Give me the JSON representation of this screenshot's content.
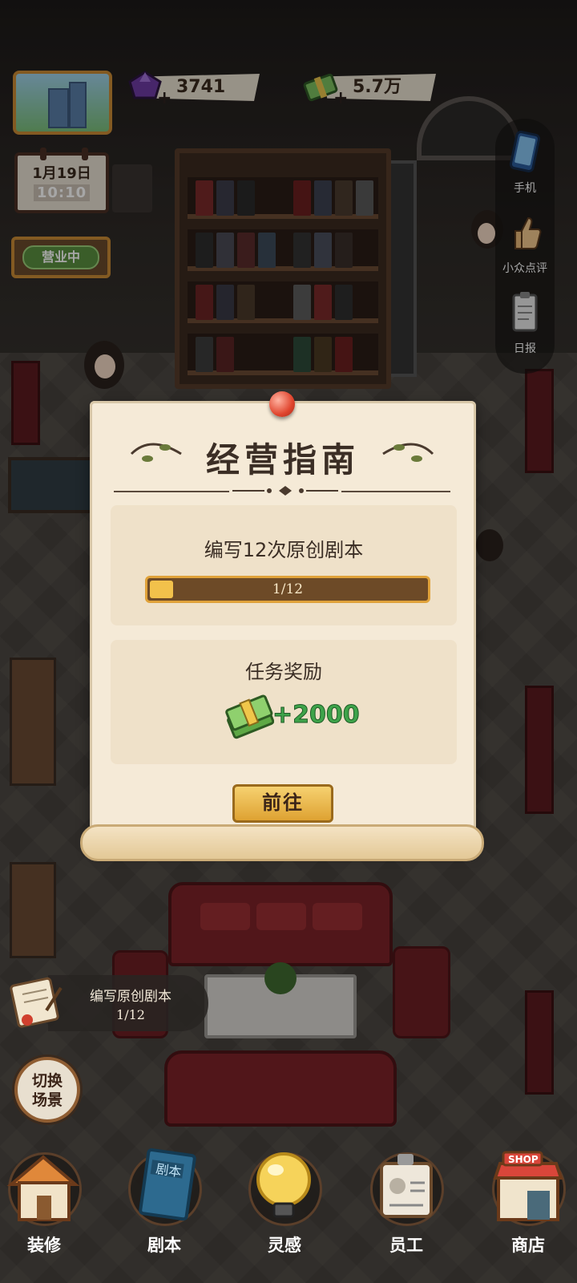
{
  "hud": {
    "gems": "3741",
    "cash": "5.7万",
    "date": "1月19日",
    "time": "10:10",
    "status_sign": "营业中"
  },
  "right_menu": [
    {
      "label": "手机",
      "icon": "phone-icon"
    },
    {
      "label": "小众点评",
      "icon": "thumbs-up-icon"
    },
    {
      "label": "日报",
      "icon": "clipboard-icon"
    }
  ],
  "modal": {
    "title": "经营指南",
    "task": "编写12次原创剧本",
    "progress_text": "1/12",
    "progress_fraction": 0.0833,
    "reward_title": "任务奖励",
    "reward_amount": "+2000",
    "reward_icon": "cash-stack-icon",
    "go_button": "前往"
  },
  "quest_tracker": {
    "name": "编写原创剧本",
    "count": "1/12"
  },
  "switch_scene": "切换\n场景",
  "switch_scene_lines": [
    "切换",
    "场景"
  ],
  "bottom_nav": [
    {
      "label": "装修",
      "icon": "house-icon"
    },
    {
      "label": "剧本",
      "icon": "script-book-icon"
    },
    {
      "label": "灵感",
      "icon": "lightbulb-icon"
    },
    {
      "label": "员工",
      "icon": "id-badge-icon"
    },
    {
      "label": "商店",
      "icon": "shop-icon"
    }
  ],
  "colors": {
    "reward_green": "#3ea34a",
    "button_gold": "#dea232",
    "progress_fill": "#f2c14b",
    "parchment": "#f5ead7"
  }
}
